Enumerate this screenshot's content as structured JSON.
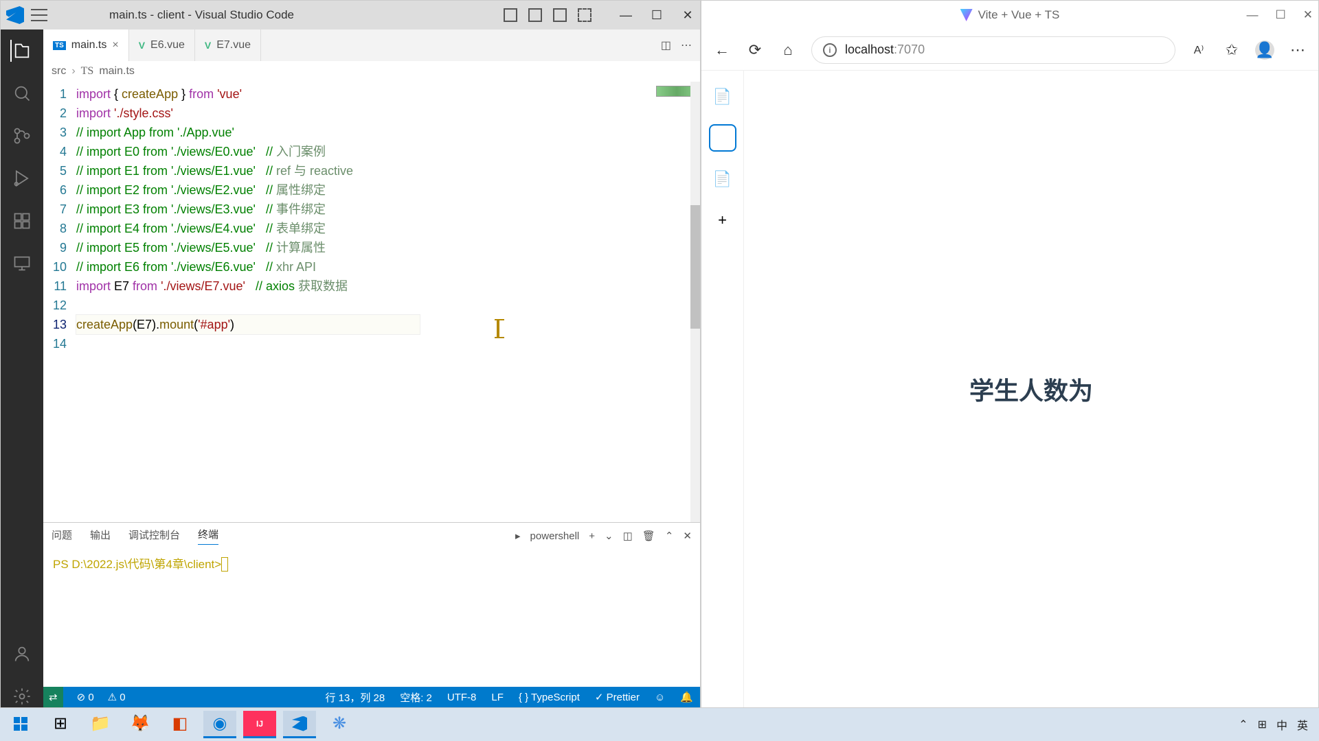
{
  "vscode": {
    "title": "main.ts - client - Visual Studio Code",
    "tabs": [
      {
        "label": "main.ts",
        "type": "ts",
        "active": true,
        "closable": true
      },
      {
        "label": "E6.vue",
        "type": "vue",
        "active": false,
        "closable": false
      },
      {
        "label": "E7.vue",
        "type": "vue",
        "active": false,
        "closable": false
      }
    ],
    "breadcrumb": {
      "a": "src",
      "b": "main.ts"
    },
    "code": [
      {
        "n": 1,
        "kind": "imp",
        "t1": "import",
        "t2": " { ",
        "t3": "createApp",
        "t4": " } ",
        "t5": "from",
        "t6": " ",
        "t7": "'vue'"
      },
      {
        "n": 2,
        "kind": "imps",
        "t1": "import",
        "t6": " ",
        "t7": "'./style.css'"
      },
      {
        "n": 3,
        "kind": "cm",
        "c": "// import App from './App.vue'"
      },
      {
        "n": 4,
        "kind": "cmz",
        "c": "// import E0 from './views/E0.vue'   // ",
        "z": "入门案例"
      },
      {
        "n": 5,
        "kind": "cmz",
        "c": "// import E1 from './views/E1.vue'   // ",
        "z": "ref 与 reactive"
      },
      {
        "n": 6,
        "kind": "cmz",
        "c": "// import E2 from './views/E2.vue'   // ",
        "z": "属性绑定"
      },
      {
        "n": 7,
        "kind": "cmz",
        "c": "// import E3 from './views/E3.vue'   // ",
        "z": "事件绑定"
      },
      {
        "n": 8,
        "kind": "cmz",
        "c": "// import E4 from './views/E4.vue'   // ",
        "z": "表单绑定"
      },
      {
        "n": 9,
        "kind": "cmz",
        "c": "// import E5 from './views/E5.vue'   // ",
        "z": "计算属性"
      },
      {
        "n": 10,
        "kind": "cmz",
        "c": "// import E6 from './views/E6.vue'   // ",
        "z": "xhr API"
      },
      {
        "n": 11,
        "kind": "impz",
        "t1": "import",
        "t2": " E7 ",
        "t5": "from",
        "t6": " ",
        "t7": "'./views/E7.vue'",
        "c": "   // axios ",
        "z": "获取数据"
      },
      {
        "n": 12,
        "kind": "blank"
      },
      {
        "n": 13,
        "kind": "call",
        "a": "createApp",
        "b": "(E7).",
        "c": "mount",
        "d": "(",
        "e": "'#app'",
        "f": ")"
      },
      {
        "n": 14,
        "kind": "blank"
      }
    ],
    "panel": {
      "tabs": {
        "problems": "问题",
        "output": "输出",
        "debug": "调试控制台",
        "terminal": "终端"
      },
      "shell": "powershell",
      "prompt": "PS D:\\2022.js\\代码\\第4章\\client> "
    },
    "status": {
      "errors": "0",
      "warnings": "0",
      "pos": "行 13，列 28",
      "spaces": "空格: 2",
      "enc": "UTF-8",
      "eol": "LF",
      "lang": "TypeScript",
      "prettier": "Prettier"
    }
  },
  "browser": {
    "title": "Vite + Vue + TS",
    "url_host": "localhost",
    "url_port": ":7070",
    "page_text": "学生人数为"
  },
  "taskbar": {
    "ime_lang": "中",
    "ime_mode": "英"
  }
}
